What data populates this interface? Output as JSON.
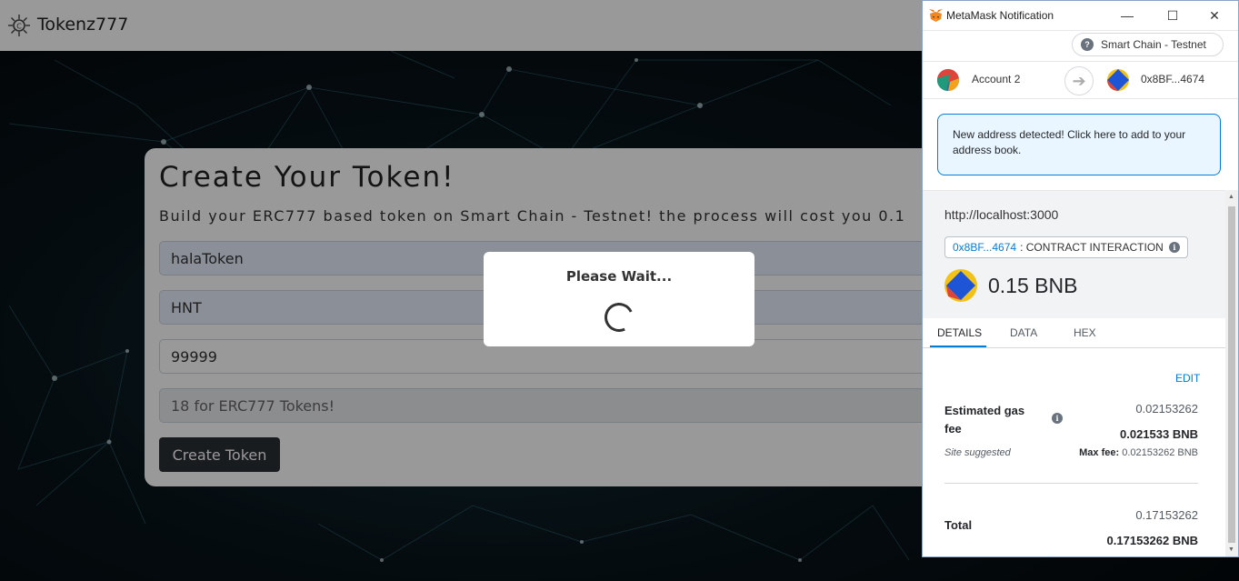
{
  "app": {
    "brand": "Tokenz777"
  },
  "card": {
    "title": "Create Your Token!",
    "subtitle": "Build your ERC777 based token on Smart Chain - Testnet! the process will cost you 0.1",
    "fields": {
      "name_value": "halaToken",
      "symbol_value": "HNT",
      "supply_value": "99999",
      "decimals_placeholder": "18 for ERC777 Tokens!"
    },
    "create_button": "Create Token"
  },
  "modal": {
    "title": "Please Wait..."
  },
  "metamask": {
    "window_title": "MetaMask Notification",
    "window_controls": {
      "minimize": "—",
      "maximize": "☐",
      "close": "✕"
    },
    "network": "Smart Chain - Testnet",
    "network_icon": "?",
    "from_account": "Account 2",
    "to_address": "0x8BF...4674",
    "alert": "New address detected! Click here to add to your address book.",
    "origin": "http://localhost:3000",
    "contract_address": "0x8BF...4674",
    "contract_label": ": CONTRACT INTERACTION",
    "info_icon": "i",
    "amount": "0.15 BNB",
    "tabs": [
      "DETAILS",
      "DATA",
      "HEX"
    ],
    "active_tab": "DETAILS",
    "edit_label": "EDIT",
    "gas": {
      "label": "Estimated gas fee",
      "value_small": "0.02153262",
      "value_bold": "0.021533 BNB",
      "site_suggested": "Site suggested",
      "max_fee_label": "Max fee:",
      "max_fee_value": "0.02153262 BNB"
    },
    "total": {
      "label": "Total",
      "value_small": "0.17153262",
      "value_bold": "0.17153262 BNB"
    },
    "colors": {
      "accent": "#037dd6",
      "alert_bg": "#eaf6ff"
    }
  }
}
